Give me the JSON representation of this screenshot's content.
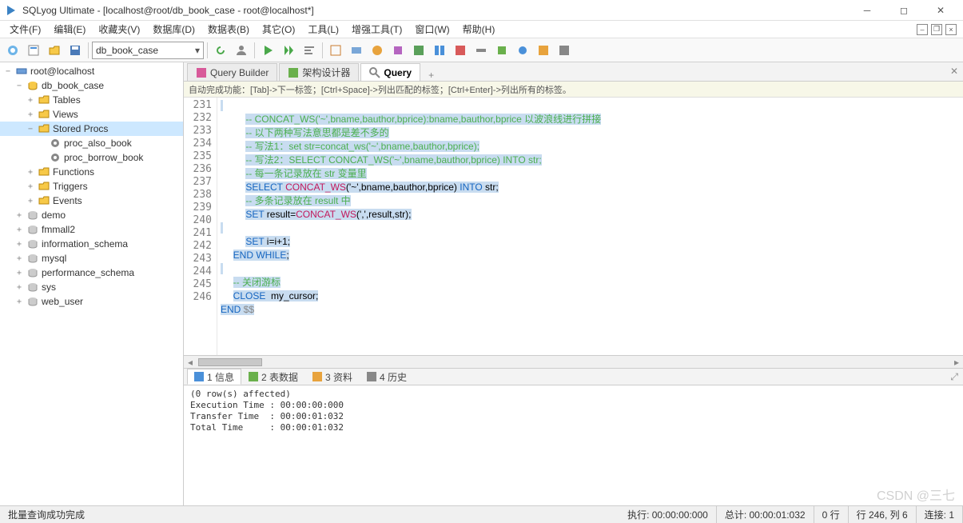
{
  "window": {
    "title": "SQLyog Ultimate - [localhost@root/db_book_case - root@localhost*]"
  },
  "menus": [
    "文件(F)",
    "编辑(E)",
    "收藏夹(V)",
    "数据库(D)",
    "数据表(B)",
    "其它(O)",
    "工具(L)",
    "增强工具(T)",
    "窗口(W)",
    "帮助(H)"
  ],
  "db_combo": "db_book_case",
  "tree": {
    "root": "root@localhost",
    "db_book_case": "db_book_case",
    "tables": "Tables",
    "views": "Views",
    "stored_procs": "Stored Procs",
    "proc_also_book": "proc_also_book",
    "proc_borrow_book": "proc_borrow_book",
    "functions": "Functions",
    "triggers": "Triggers",
    "events": "Events",
    "demo": "demo",
    "fmmall2": "fmmall2",
    "information_schema": "information_schema",
    "mysql": "mysql",
    "performance_schema": "performance_schema",
    "sys": "sys",
    "web_user": "web_user"
  },
  "editor_tabs": {
    "qb": "Query Builder",
    "sd": "架构设计器",
    "q": "Query"
  },
  "hint": "自动完成功能：[Tab]->下一标签；[Ctrl+Space]->列出匹配的标签；[Ctrl+Enter]->列出所有的标签。",
  "code": {
    "lines": [
      "231",
      "232",
      "233",
      "234",
      "235",
      "236",
      "237",
      "238",
      "239",
      "240",
      "241",
      "242",
      "243",
      "244",
      "245",
      "246"
    ],
    "l232": "-- CONCAT_WS('~',bname,bauthor,bprice):bname,bauthor,bprice 以波浪线进行拼接",
    "l233": "-- 以下两种写法意思都是差不多的",
    "l234": "-- 写法1：set str=concat_ws('~',bname,bauthor,bprice);",
    "l235": "-- 写法2：SELECT CONCAT_WS('~',bname,bauthor,bprice) INTO str;",
    "l236": "-- 每一条记录放在 str 变量里",
    "l237_select": "SELECT",
    "l237_fn": "CONCAT_WS",
    "l237_args": "('~',bname,bauthor,bprice)",
    "l237_into": "INTO",
    "l237_str": "str;",
    "l238": "-- 多条记录放在 result 中",
    "l239_set": "SET",
    "l239_rest": " result=",
    "l239_fn": "CONCAT_WS",
    "l239_args": "(',',result,str);",
    "l241_set": "SET",
    "l241_rest": " i=i+1;",
    "l242_end": "END",
    "l242_while": " WHILE",
    "l242_semi": ";",
    "l244": "-- 关闭游标",
    "l245_close": "CLOSE",
    "l245_cur": "  my_cursor;",
    "l246_end": "END",
    "l246_dd": " $$"
  },
  "result_tabs": {
    "t1": "1 信息",
    "t2": "2 表数据",
    "t3": "3 资料",
    "t4": "4 历史"
  },
  "result_body": "(0 row(s) affected)\nExecution Time : 00:00:00:000\nTransfer Time  : 00:00:01:032\nTotal Time     : 00:00:01:032",
  "status": {
    "msg": "批量查询成功完成",
    "exec": "执行: 00:00:00:000",
    "total": "总计: 00:00:01:032",
    "rows": "0 行",
    "pos": "行 246, 列 6",
    "conn": "连接: 1"
  },
  "watermark": "CSDN @三七"
}
